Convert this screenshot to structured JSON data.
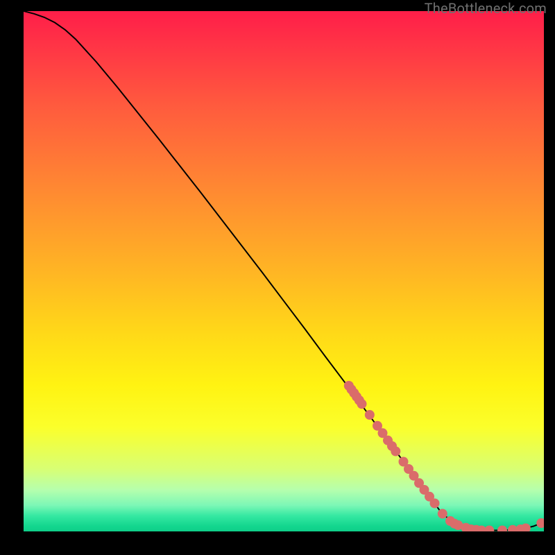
{
  "watermark": "TheBottleneck.com",
  "colors": {
    "page_bg": "#000000",
    "watermark": "#6f6f6f",
    "curve_stroke": "#000000",
    "marker_fill": "#da6c6a",
    "gradient_stops": [
      "#ff1e49",
      "#ff3246",
      "#ff5a3e",
      "#ff8832",
      "#ffb524",
      "#ffd918",
      "#fff312",
      "#fbff2b",
      "#d8ff74",
      "#b6ffad",
      "#7cf7b6",
      "#35e8a2",
      "#13d68e",
      "#0fcf89"
    ]
  },
  "chart_data": {
    "type": "line",
    "title": "",
    "xlabel": "",
    "ylabel": "",
    "xlim": [
      0,
      100
    ],
    "ylim": [
      0,
      100
    ],
    "grid": false,
    "legend": false,
    "series": [
      {
        "name": "curve",
        "x": [
          0,
          2,
          4,
          6,
          8,
          10,
          14,
          18,
          22,
          26,
          30,
          34,
          38,
          42,
          46,
          50,
          54,
          58,
          62,
          66,
          70,
          74,
          78,
          80,
          82,
          84,
          86,
          88,
          90,
          92,
          94,
          96,
          98,
          100
        ],
        "y": [
          100,
          99.5,
          98.8,
          97.8,
          96.4,
          94.6,
          90.2,
          85.4,
          80.4,
          75.4,
          70.3,
          65.2,
          60.0,
          54.8,
          49.6,
          44.3,
          39.0,
          33.6,
          28.3,
          22.9,
          17.5,
          12.1,
          6.7,
          4.0,
          2.1,
          1.0,
          0.4,
          0.2,
          0.2,
          0.2,
          0.3,
          0.5,
          1.0,
          1.8
        ]
      }
    ],
    "markers": {
      "name": "measured-points",
      "x": [
        62.5,
        63.0,
        63.5,
        64.0,
        64.5,
        65.0,
        66.5,
        68.0,
        69.0,
        70.0,
        70.8,
        71.5,
        73.0,
        74.0,
        75.0,
        76.0,
        77.0,
        78.0,
        79.0,
        80.5,
        82.0,
        82.8,
        83.5,
        85.0,
        86.0,
        87.0,
        88.0,
        89.5,
        92.0,
        94.0,
        95.5,
        96.5,
        99.5
      ],
      "y": [
        28.0,
        27.3,
        26.6,
        25.9,
        25.2,
        24.5,
        22.4,
        20.3,
        18.9,
        17.5,
        16.4,
        15.4,
        13.4,
        12.0,
        10.7,
        9.3,
        8.0,
        6.7,
        5.4,
        3.4,
        2.0,
        1.5,
        1.2,
        0.7,
        0.4,
        0.3,
        0.2,
        0.2,
        0.2,
        0.3,
        0.4,
        0.6,
        1.6
      ]
    }
  }
}
